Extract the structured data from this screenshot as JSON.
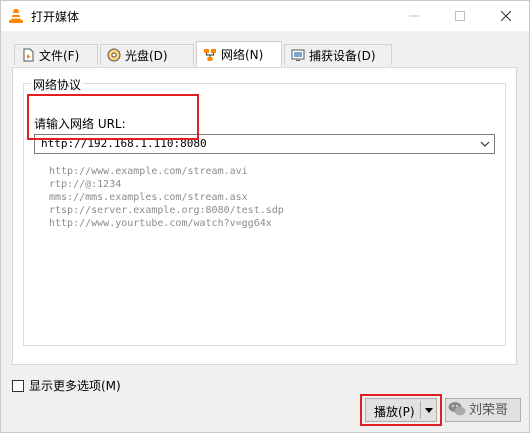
{
  "window": {
    "title": "打开媒体",
    "icon": "vlc-cone-icon"
  },
  "tabs": [
    {
      "label": "文件(F)",
      "icon": "file-icon",
      "active": false
    },
    {
      "label": "光盘(D)",
      "icon": "disc-icon",
      "active": false
    },
    {
      "label": "网络(N)",
      "icon": "network-icon",
      "active": true
    },
    {
      "label": "捕获设备(D)",
      "icon": "capture-device-icon",
      "active": false
    }
  ],
  "network": {
    "group_title": "网络协议",
    "url_label": "请输入网络 URL:",
    "url_value": "http://192.168.1.110:8080",
    "examples": [
      "http://www.example.com/stream.avi",
      "rtp://@:1234",
      "mms://mms.examples.com/stream.asx",
      "rtsp://server.example.org:8080/test.sdp",
      "http://www.yourtube.com/watch?v=gg64x"
    ]
  },
  "footer": {
    "more_options_label": "显示更多选项(M)",
    "more_options_checked": false,
    "play_label": "播放(P)",
    "watermark_text": "刘荣哥"
  },
  "colors": {
    "highlight": "#e02020",
    "example_text": "#8c8c8c"
  }
}
